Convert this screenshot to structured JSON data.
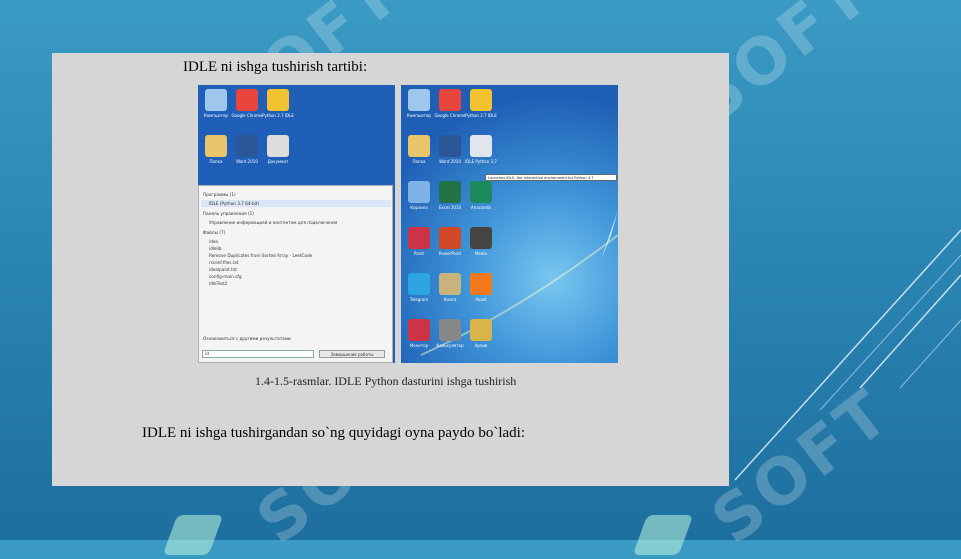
{
  "slide": {
    "watermark_text": "SOFT",
    "colors": {
      "background_top": "#3a9bc4",
      "background_bottom": "#1d6f9e",
      "document": "#d6d6d6"
    }
  },
  "document": {
    "title": "IDLE ni ishga tushirish tartibi:",
    "caption": "1.4-1.5-rasmlar. IDLE Python dasturini ishga tushirish",
    "body": "IDLE ni ishga tushirgandan so`ng quyidagi  oyna paydo bo`ladi:"
  },
  "left_screenshot": {
    "desktop_icons": [
      {
        "label": "Компьютер",
        "icon": "computer-icon",
        "color": "#9fc7ee"
      },
      {
        "label": "Google Chrome",
        "icon": "chrome-icon",
        "color": "#e8453c"
      },
      {
        "label": "Python 2.7 IDLE",
        "icon": "python-icon",
        "color": "#f2c230"
      },
      {
        "label": "Папка",
        "icon": "folder-icon",
        "color": "#e9c46a"
      },
      {
        "label": "Word 2010",
        "icon": "word-icon",
        "color": "#2b5797"
      },
      {
        "label": "Документ",
        "icon": "document-icon",
        "color": "#dddddd"
      }
    ],
    "start_menu": {
      "programs_header": "Программы (1)",
      "program_item": "IDLE (Python 3.7 64-bit)",
      "control_panel_header": "Панель управления (1)",
      "control_panel_item": "Управление информацией и контентом для подключения",
      "files_header": "Файлы (7)",
      "files": [
        "idea",
        "idlelib",
        "Remove Duplicates from Sorted Array - LeetCode",
        "rsconf.files.txt",
        "idealpaint.txt",
        "config-main.cfg",
        "IdleTest2"
      ],
      "see_more": "Ознакомиться с другими результатами",
      "search_value": "id",
      "shutdown_label": "Завершение работы"
    }
  },
  "right_screenshot": {
    "tooltip": "Launches IDLE, the interactive environment for Python 3.7",
    "desktop_icons": [
      {
        "label": "Компьютер",
        "icon": "computer-icon",
        "color": "#9fc7ee"
      },
      {
        "label": "Google Chrome",
        "icon": "chrome-icon",
        "color": "#e8453c"
      },
      {
        "label": "Python 2.7 IDLE",
        "icon": "python-icon",
        "color": "#f2c230"
      },
      {
        "label": "Папка",
        "icon": "folder-icon",
        "color": "#e9c46a"
      },
      {
        "label": "Word 2010",
        "icon": "word-icon",
        "color": "#2b5797"
      },
      {
        "label": "IDLE Python 3.7",
        "icon": "idle-icon",
        "color": "#dfe6ee"
      },
      {
        "label": "Корзина",
        "icon": "recycle-bin-icon",
        "color": "#7fb2e5"
      },
      {
        "label": "Excel 2010",
        "icon": "excel-icon",
        "color": "#217346"
      },
      {
        "label": "Anaconda",
        "icon": "anaconda-icon",
        "color": "#1c8a5a"
      },
      {
        "label": "Paint",
        "icon": "paint-icon",
        "color": "#cc3344"
      },
      {
        "label": "PowerPoint",
        "icon": "powerpoint-icon",
        "color": "#d24726"
      },
      {
        "label": "Media",
        "icon": "media-icon",
        "color": "#444444"
      },
      {
        "label": "Telegram",
        "icon": "telegram-icon",
        "color": "#2ca5e0"
      },
      {
        "label": "Книга",
        "icon": "book-icon",
        "color": "#c8b37c"
      },
      {
        "label": "Avast",
        "icon": "avast-icon",
        "color": "#f27a1a"
      },
      {
        "label": "Монитор",
        "icon": "monitor-icon",
        "color": "#cc3344"
      },
      {
        "label": "Калькулятор",
        "icon": "calculator-icon",
        "color": "#888888"
      },
      {
        "label": "Архив",
        "icon": "archive-icon",
        "color": "#d9b44a"
      }
    ]
  }
}
